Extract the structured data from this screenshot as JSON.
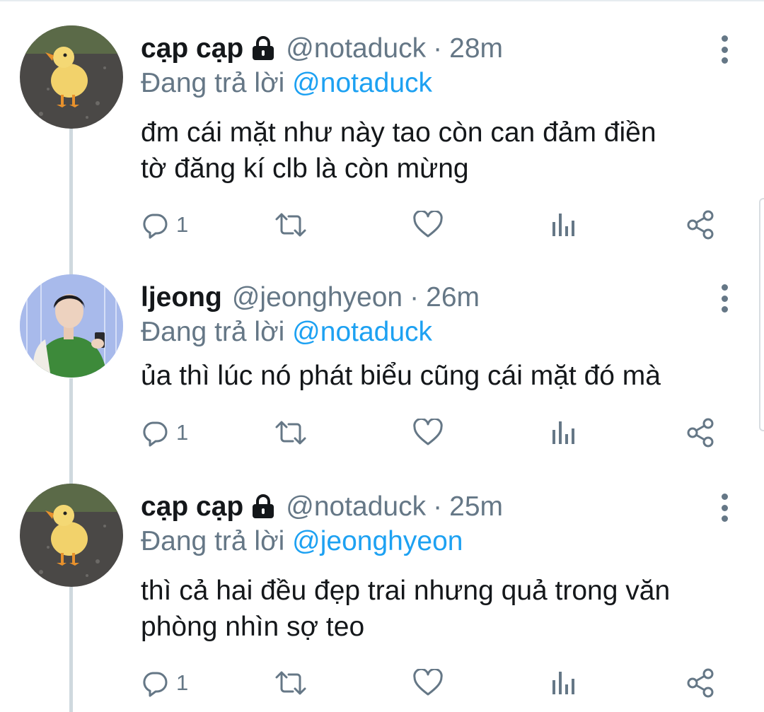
{
  "replying_label": "Đang trả lời",
  "reply_count_label": "1",
  "colors": {
    "link": "#1da1f2",
    "secondary": "#657786",
    "primary": "#14171a"
  },
  "tweets": [
    {
      "display_name": "cạp cạp",
      "handle": "@notaduck",
      "dot": "·",
      "time": "28m",
      "replying_to": "@notaduck",
      "text_lines": [
        "đm cái mặt như này tao còn can đảm điền",
        "tờ đăng kí clb là còn mừng"
      ],
      "reply_count": "1",
      "locked": true,
      "avatar": "duckling"
    },
    {
      "display_name": "ljeong",
      "handle": "@jeonghyeon",
      "dot": "·",
      "time": "26m",
      "replying_to": "@notaduck",
      "text_lines": [
        "ủa thì lúc nó phát biểu cũng cái mặt đó mà"
      ],
      "reply_count": "1",
      "locked": false,
      "avatar": "person-green-vest"
    },
    {
      "display_name": "cạp cạp",
      "handle": "@notaduck",
      "dot": "·",
      "time": "25m",
      "replying_to": "@jeonghyeon",
      "text_lines": [
        "thì cả hai đều đẹp trai nhưng quả trong văn",
        "phòng nhìn sợ teo"
      ],
      "reply_count": "1",
      "locked": true,
      "avatar": "duckling"
    }
  ],
  "icons": {
    "reply": "reply-icon",
    "retweet": "retweet-icon",
    "like": "heart-icon",
    "analytics": "analytics-icon",
    "share": "share-icon",
    "more": "more-vertical-icon",
    "lock": "lock-icon"
  }
}
